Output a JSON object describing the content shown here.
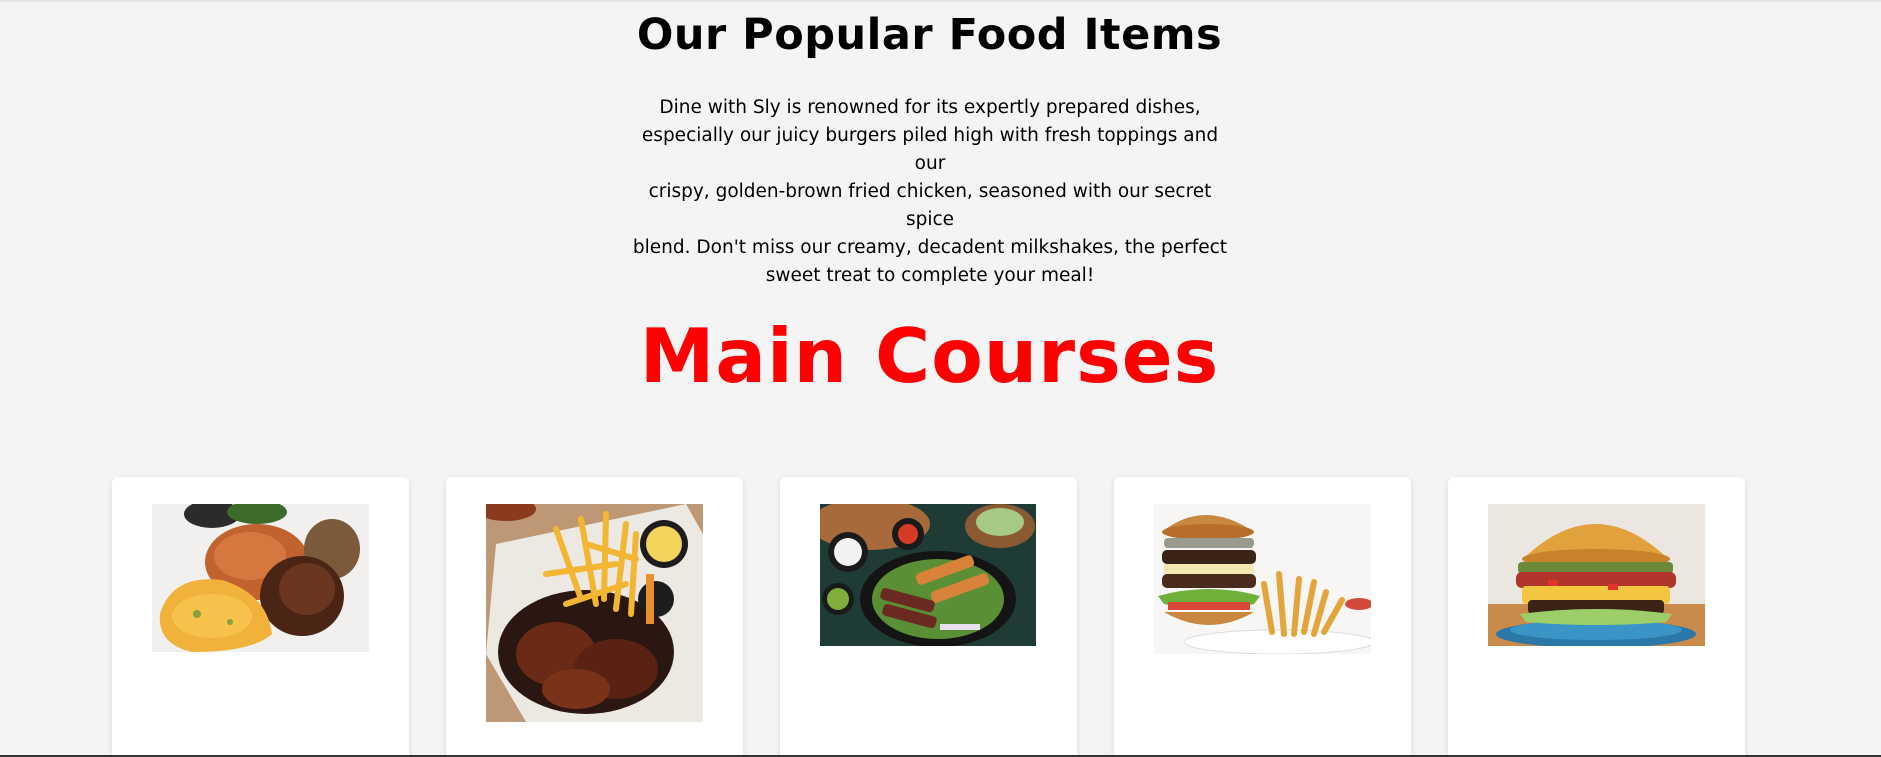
{
  "section": {
    "title": "Our Popular Food Items",
    "intro_lines": [
      "Dine with Sly is renowned for its expertly prepared dishes,",
      "especially our juicy burgers piled high with fresh toppings and our",
      "crispy, golden-brown fried chicken, seasoned with our secret spice",
      "blend. Don't miss our creamy, decadent milkshakes, the perfect",
      "sweet treat to complete your meal!"
    ]
  },
  "main_courses": {
    "title": "Main Courses",
    "cards": [
      {
        "image": "jollof-rice-chicken-image"
      },
      {
        "image": "wings-and-fries-image"
      },
      {
        "image": "steak-chicken-salad-image"
      },
      {
        "image": "burger-and-fries-image"
      },
      {
        "image": "loaded-burger-image"
      }
    ]
  },
  "colors": {
    "background": "#f4f4f4",
    "main_title": "#ff0000",
    "card": "#ffffff"
  }
}
